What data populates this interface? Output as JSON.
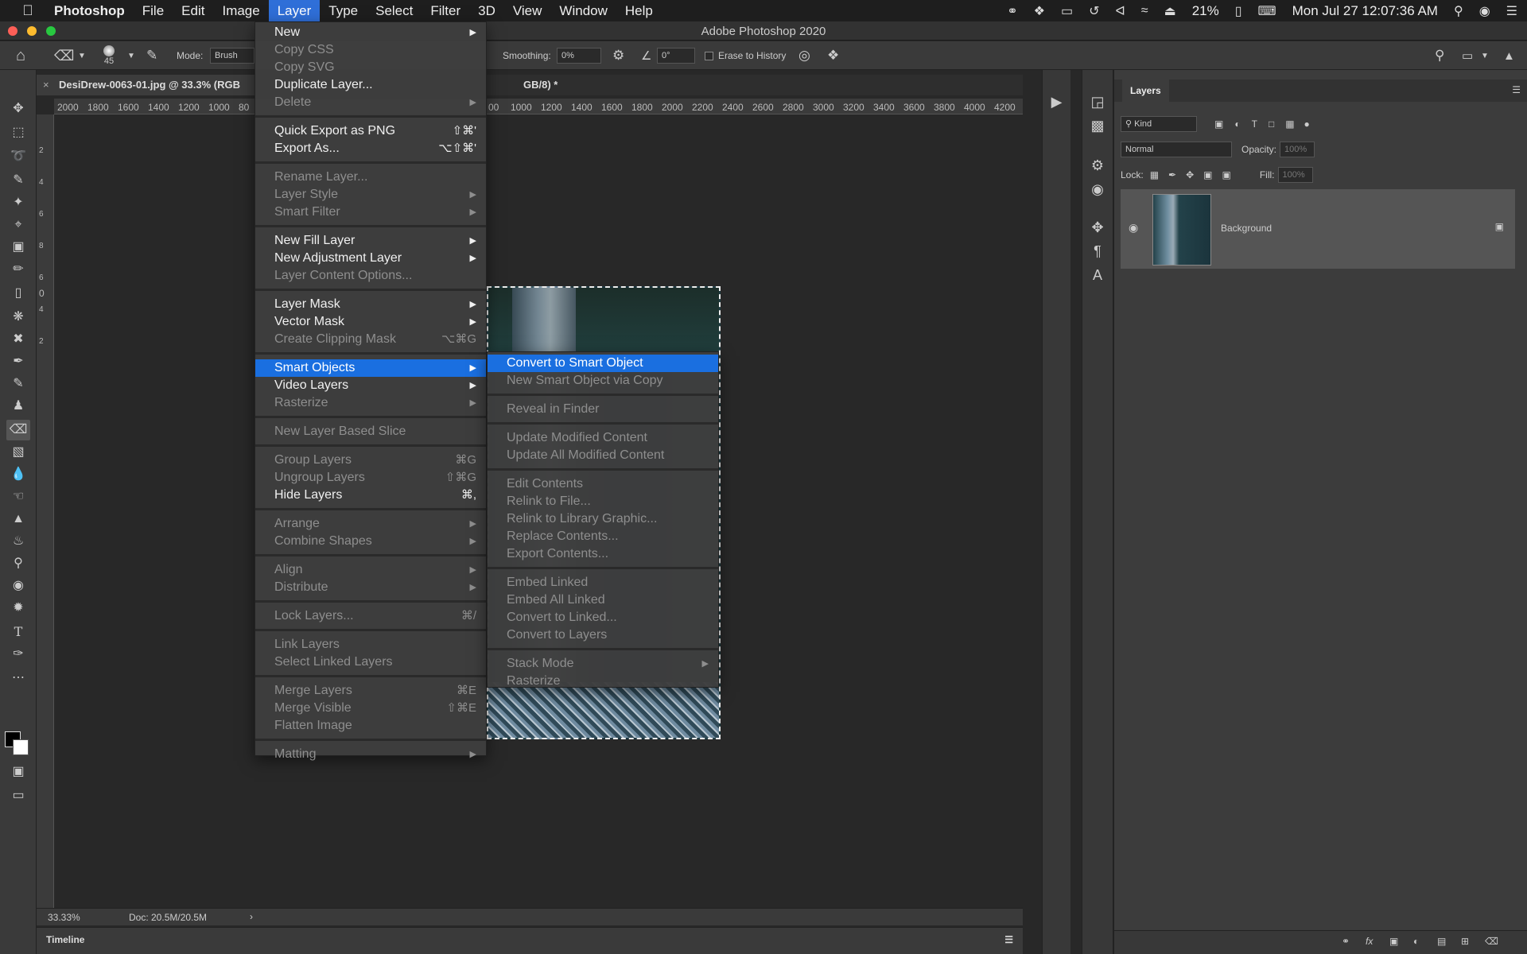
{
  "menubar": {
    "app": "Photoshop",
    "items": [
      "File",
      "Edit",
      "Image",
      "Layer",
      "Type",
      "Select",
      "Filter",
      "3D",
      "View",
      "Window",
      "Help"
    ],
    "battery": "21%",
    "clock": "Mon Jul 27  12:07:36 AM"
  },
  "window": {
    "title": "Adobe Photoshop 2020"
  },
  "options": {
    "brush_size": "45",
    "mode_label": "Mode:",
    "mode_value": "Brush",
    "smoothing_label": "Smoothing:",
    "smoothing_value": "0%",
    "angle_value": "0°",
    "erase_history": "Erase to History"
  },
  "document": {
    "tab_title": "DesiDrew-0063-01.jpg @ 33.3% (RGB",
    "tab_suffix": "GB/8) *",
    "zoom": "33.33%",
    "doc_info": "Doc: 20.5M/20.5M"
  },
  "ruler": {
    "h_left": [
      "2000",
      "1800",
      "1600",
      "1400",
      "1200",
      "1000",
      "80"
    ],
    "h_right": [
      "00",
      "1000",
      "1200",
      "1400",
      "1600",
      "1800",
      "2000",
      "2200",
      "2400",
      "2600",
      "2800",
      "3000",
      "3200",
      "3400",
      "3600",
      "3800",
      "4000",
      "4200"
    ],
    "v": [
      "2",
      "4",
      "6",
      "8",
      "6",
      "4",
      "2",
      "0"
    ]
  },
  "timeline": {
    "label": "Timeline"
  },
  "layer_menu": [
    {
      "label": "New",
      "arrow": true
    },
    {
      "label": "Copy CSS",
      "disabled": true
    },
    {
      "label": "Copy SVG",
      "disabled": true
    },
    {
      "label": "Duplicate Layer..."
    },
    {
      "label": "Delete",
      "disabled": true,
      "arrow": true
    },
    {
      "sep": true
    },
    {
      "label": "Quick Export as PNG",
      "shortcut": "⇧⌘'"
    },
    {
      "label": "Export As...",
      "shortcut": "⌥⇧⌘'"
    },
    {
      "sep": true
    },
    {
      "label": "Rename Layer...",
      "disabled": true
    },
    {
      "label": "Layer Style",
      "disabled": true,
      "arrow": true
    },
    {
      "label": "Smart Filter",
      "disabled": true,
      "arrow": true
    },
    {
      "sep": true
    },
    {
      "label": "New Fill Layer",
      "arrow": true
    },
    {
      "label": "New Adjustment Layer",
      "arrow": true
    },
    {
      "label": "Layer Content Options...",
      "disabled": true
    },
    {
      "sep": true
    },
    {
      "label": "Layer Mask",
      "arrow": true
    },
    {
      "label": "Vector Mask",
      "arrow": true
    },
    {
      "label": "Create Clipping Mask",
      "disabled": true,
      "shortcut": "⌥⌘G"
    },
    {
      "sep": true
    },
    {
      "label": "Smart Objects",
      "arrow": true,
      "highlighted": true
    },
    {
      "label": "Video Layers",
      "arrow": true
    },
    {
      "label": "Rasterize",
      "disabled": true,
      "arrow": true
    },
    {
      "sep": true
    },
    {
      "label": "New Layer Based Slice",
      "disabled": true
    },
    {
      "sep": true
    },
    {
      "label": "Group Layers",
      "disabled": true,
      "shortcut": "⌘G"
    },
    {
      "label": "Ungroup Layers",
      "disabled": true,
      "shortcut": "⇧⌘G"
    },
    {
      "label": "Hide Layers",
      "shortcut": "⌘,"
    },
    {
      "sep": true
    },
    {
      "label": "Arrange",
      "disabled": true,
      "arrow": true
    },
    {
      "label": "Combine Shapes",
      "disabled": true,
      "arrow": true
    },
    {
      "sep": true
    },
    {
      "label": "Align",
      "disabled": true,
      "arrow": true
    },
    {
      "label": "Distribute",
      "disabled": true,
      "arrow": true
    },
    {
      "sep": true
    },
    {
      "label": "Lock Layers...",
      "disabled": true,
      "shortcut": "⌘/"
    },
    {
      "sep": true
    },
    {
      "label": "Link Layers",
      "disabled": true
    },
    {
      "label": "Select Linked Layers",
      "disabled": true
    },
    {
      "sep": true
    },
    {
      "label": "Merge Layers",
      "disabled": true,
      "shortcut": "⌘E"
    },
    {
      "label": "Merge Visible",
      "disabled": true,
      "shortcut": "⇧⌘E"
    },
    {
      "label": "Flatten Image",
      "disabled": true
    },
    {
      "sep": true
    },
    {
      "label": "Matting",
      "disabled": true,
      "arrow": true
    }
  ],
  "smart_menu": [
    {
      "label": "Convert to Smart Object",
      "highlighted": true
    },
    {
      "label": "New Smart Object via Copy",
      "disabled": true
    },
    {
      "sep": true
    },
    {
      "label": "Reveal in Finder",
      "disabled": true
    },
    {
      "sep": true
    },
    {
      "label": "Update Modified Content",
      "disabled": true
    },
    {
      "label": "Update All Modified Content",
      "disabled": true
    },
    {
      "sep": true
    },
    {
      "label": "Edit Contents",
      "disabled": true
    },
    {
      "label": "Relink to File...",
      "disabled": true
    },
    {
      "label": "Relink to Library Graphic...",
      "disabled": true
    },
    {
      "label": "Replace Contents...",
      "disabled": true
    },
    {
      "label": "Export Contents...",
      "disabled": true
    },
    {
      "sep": true
    },
    {
      "label": "Embed Linked",
      "disabled": true
    },
    {
      "label": "Embed All Linked",
      "disabled": true
    },
    {
      "label": "Convert to Linked...",
      "disabled": true
    },
    {
      "label": "Convert to Layers",
      "disabled": true
    },
    {
      "sep": true
    },
    {
      "label": "Stack Mode",
      "disabled": true,
      "arrow": true
    },
    {
      "label": "Rasterize",
      "disabled": true
    }
  ],
  "layers_panel": {
    "title": "Layers",
    "kind": "Kind",
    "blend": "Normal",
    "opacity_label": "Opacity:",
    "opacity_value": "100%",
    "lock_label": "Lock:",
    "fill_label": "Fill:",
    "fill_value": "100%",
    "layer_name": "Background"
  }
}
